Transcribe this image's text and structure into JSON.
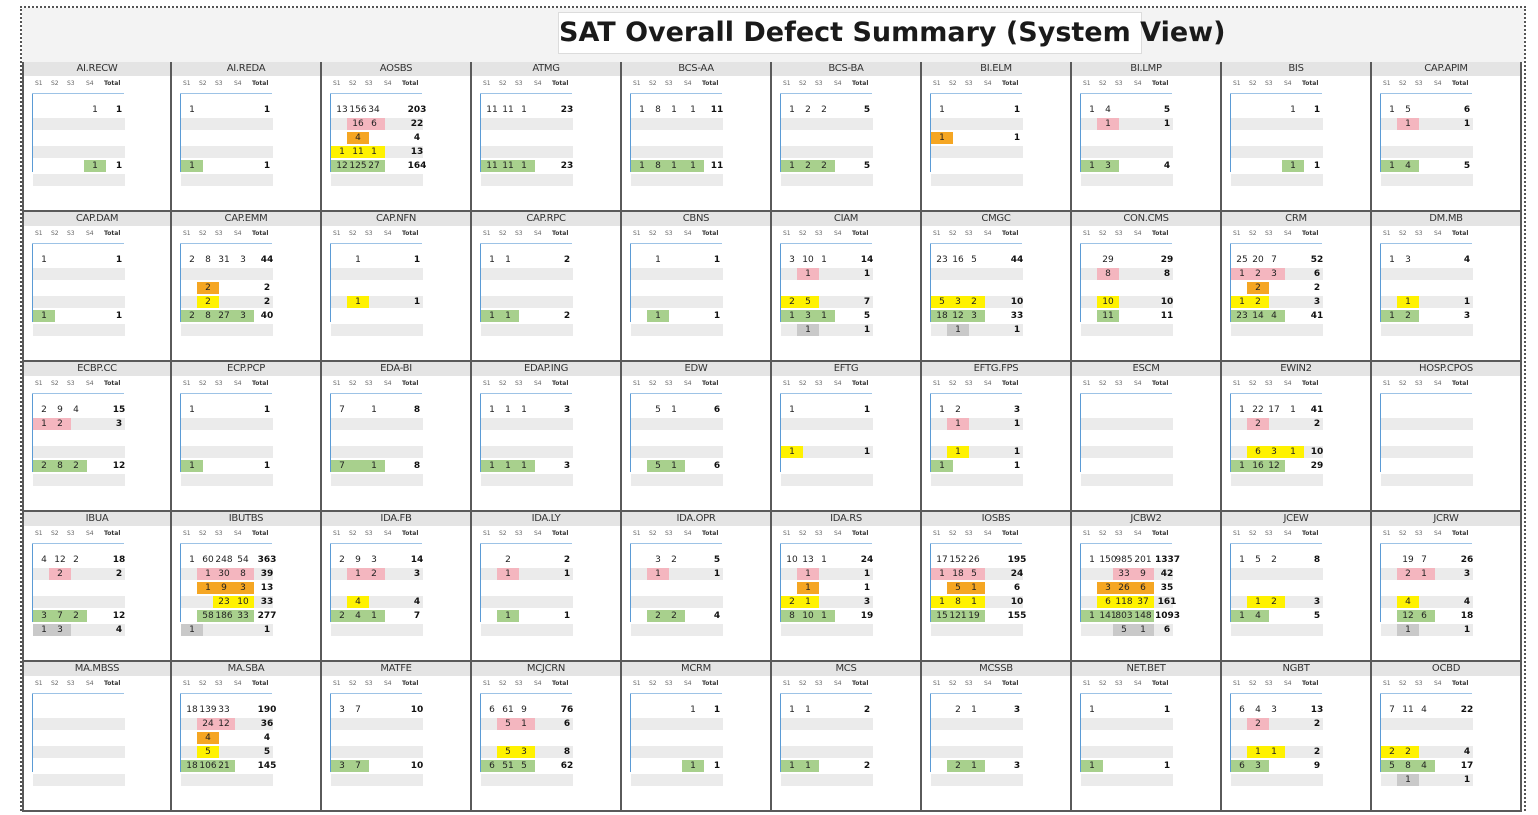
{
  "title": "SAT Overall Defect Summary (System View)",
  "columns": [
    "S1",
    "S2",
    "S3",
    "S4",
    "Total"
  ],
  "colors": {
    "s1": "#f4b6bf",
    "s2": "#f5a623",
    "s3": "#fff200",
    "s4": "#a8d08d",
    "s5": "#c9c9c9"
  },
  "panels": [
    {
      "name": "AI.RECW",
      "rows": [
        [
          "",
          "",
          "",
          "1",
          "1"
        ],
        [],
        [],
        [],
        [
          "",
          "",
          "",
          "1",
          "1"
        ]
      ]
    },
    {
      "name": "AI.REDA",
      "rows": [
        [
          "1",
          "",
          "",
          "",
          "1"
        ],
        [],
        [],
        [],
        [
          "1",
          "",
          "",
          "",
          "1"
        ]
      ]
    },
    {
      "name": "AOSBS",
      "rows": [
        [
          "13",
          "156",
          "34",
          "",
          "203"
        ],
        [
          "",
          "16",
          "6",
          "",
          "22"
        ],
        [
          "",
          "4",
          "",
          "",
          "4"
        ],
        [
          "1",
          "11",
          "1",
          "",
          "13"
        ],
        [
          "12",
          "125",
          "27",
          "",
          "164"
        ]
      ]
    },
    {
      "name": "ATMG",
      "rows": [
        [
          "11",
          "11",
          "1",
          "",
          "23"
        ],
        [],
        [],
        [],
        [
          "11",
          "11",
          "1",
          "",
          "23"
        ]
      ]
    },
    {
      "name": "BCS-AA",
      "rows": [
        [
          "1",
          "8",
          "1",
          "1",
          "11"
        ],
        [],
        [],
        [],
        [
          "1",
          "8",
          "1",
          "1",
          "11"
        ]
      ]
    },
    {
      "name": "BCS-BA",
      "rows": [
        [
          "1",
          "2",
          "2",
          "",
          "5"
        ],
        [],
        [],
        [],
        [
          "1",
          "2",
          "2",
          "",
          "5"
        ]
      ]
    },
    {
      "name": "BI.ELM",
      "rows": [
        [
          "1",
          "",
          "",
          "",
          "1"
        ],
        [],
        [
          "1",
          "",
          "",
          "",
          "1"
        ],
        [],
        []
      ]
    },
    {
      "name": "BI.LMP",
      "rows": [
        [
          "1",
          "4",
          "",
          "",
          "5"
        ],
        [
          "",
          "1",
          "",
          "",
          "1"
        ],
        [],
        [],
        [
          "1",
          "3",
          "",
          "",
          "4"
        ]
      ]
    },
    {
      "name": "BIS",
      "rows": [
        [
          "",
          "",
          "",
          "1",
          "1"
        ],
        [],
        [],
        [],
        [
          "",
          "",
          "",
          "1",
          "1"
        ]
      ]
    },
    {
      "name": "CAP.APIM",
      "rows": [
        [
          "1",
          "5",
          "",
          "",
          "6"
        ],
        [
          "",
          "1",
          "",
          "",
          "1"
        ],
        [],
        [],
        [
          "1",
          "4",
          "",
          "",
          "5"
        ]
      ]
    },
    {
      "name": "CAP.DAM",
      "rows": [
        [
          "1",
          "",
          "",
          "",
          "1"
        ],
        [],
        [],
        [],
        [
          "1",
          "",
          "",
          "",
          "1"
        ]
      ]
    },
    {
      "name": "CAP.EMM",
      "rows": [
        [
          "2",
          "8",
          "31",
          "3",
          "44"
        ],
        [],
        [
          "",
          "2",
          "",
          "",
          "2"
        ],
        [
          "",
          "2",
          "",
          "",
          "2"
        ],
        [
          "2",
          "8",
          "27",
          "3",
          "40"
        ]
      ]
    },
    {
      "name": "CAP.NFN",
      "rows": [
        [
          "",
          "1",
          "",
          "",
          "1"
        ],
        [],
        [],
        [
          "",
          "1",
          "",
          "",
          "1"
        ],
        []
      ]
    },
    {
      "name": "CAP.RPC",
      "rows": [
        [
          "1",
          "1",
          "",
          "",
          "2"
        ],
        [],
        [],
        [],
        [
          "1",
          "1",
          "",
          "",
          "2"
        ]
      ]
    },
    {
      "name": "CBNS",
      "rows": [
        [
          "",
          "1",
          "",
          "",
          "1"
        ],
        [],
        [],
        [],
        [
          "",
          "1",
          "",
          "",
          "1"
        ]
      ]
    },
    {
      "name": "CIAM",
      "rows": [
        [
          "3",
          "10",
          "1",
          "",
          "14"
        ],
        [
          "",
          "1",
          "",
          "",
          "1"
        ],
        [],
        [
          "2",
          "5",
          "",
          "",
          "7"
        ],
        [
          "1",
          "3",
          "1",
          "",
          "5"
        ],
        [
          "",
          "1",
          "",
          "",
          "1"
        ]
      ]
    },
    {
      "name": "CMGC",
      "rows": [
        [
          "23",
          "16",
          "5",
          "",
          "44"
        ],
        [],
        [],
        [
          "5",
          "3",
          "2",
          "",
          "10"
        ],
        [
          "18",
          "12",
          "3",
          "",
          "33"
        ],
        [
          "",
          "1",
          "",
          "",
          "1"
        ]
      ]
    },
    {
      "name": "CON.CMS",
      "rows": [
        [
          "",
          "29",
          "",
          "",
          "29"
        ],
        [
          "",
          "8",
          "",
          "",
          "8"
        ],
        [],
        [
          "",
          "10",
          "",
          "",
          "10"
        ],
        [
          "",
          "11",
          "",
          "",
          "11"
        ]
      ]
    },
    {
      "name": "CRM",
      "rows": [
        [
          "25",
          "20",
          "7",
          "",
          "52"
        ],
        [
          "1",
          "2",
          "3",
          "",
          "6"
        ],
        [
          "",
          "2",
          "",
          "",
          "2"
        ],
        [
          "1",
          "2",
          "",
          "",
          "3"
        ],
        [
          "23",
          "14",
          "4",
          "",
          "41"
        ]
      ]
    },
    {
      "name": "DM.MB",
      "rows": [
        [
          "1",
          "3",
          "",
          "",
          "4"
        ],
        [],
        [],
        [
          "",
          "1",
          "",
          "",
          "1"
        ],
        [
          "1",
          "2",
          "",
          "",
          "3"
        ]
      ]
    },
    {
      "name": "ECBP.CC",
      "rows": [
        [
          "2",
          "9",
          "4",
          "",
          "15"
        ],
        [
          "1",
          "2",
          "",
          "",
          "3"
        ],
        [],
        [],
        [
          "2",
          "8",
          "2",
          "",
          "12"
        ]
      ]
    },
    {
      "name": "ECP.PCP",
      "rows": [
        [
          "1",
          "",
          "",
          "",
          "1"
        ],
        [],
        [],
        [],
        [
          "1",
          "",
          "",
          "",
          "1"
        ]
      ]
    },
    {
      "name": "EDA-BI",
      "rows": [
        [
          "7",
          "",
          "1",
          "",
          "8"
        ],
        [],
        [],
        [],
        [
          "7",
          "",
          "1",
          "",
          "8"
        ]
      ]
    },
    {
      "name": "EDAP.ING",
      "rows": [
        [
          "1",
          "1",
          "1",
          "",
          "3"
        ],
        [],
        [],
        [],
        [
          "1",
          "1",
          "1",
          "",
          "3"
        ]
      ]
    },
    {
      "name": "EDW",
      "rows": [
        [
          "",
          "5",
          "1",
          "",
          "6"
        ],
        [],
        [],
        [],
        [
          "",
          "5",
          "1",
          "",
          "6"
        ]
      ]
    },
    {
      "name": "EFTG",
      "rows": [
        [
          "1",
          "",
          "",
          "",
          "1"
        ],
        [],
        [],
        [
          "1",
          "",
          "",
          "",
          "1"
        ],
        []
      ]
    },
    {
      "name": "EFTG.FPS",
      "rows": [
        [
          "1",
          "2",
          "",
          "",
          "3"
        ],
        [
          "",
          "1",
          "",
          "",
          "1"
        ],
        [],
        [
          "",
          "1",
          "",
          "",
          "1"
        ],
        [
          "1",
          "",
          "",
          "",
          "1"
        ]
      ]
    },
    {
      "name": "ESCM",
      "rows": [
        [],
        [],
        [],
        [],
        []
      ]
    },
    {
      "name": "EWIN2",
      "rows": [
        [
          "1",
          "22",
          "17",
          "1",
          "41"
        ],
        [
          "",
          "2",
          "",
          "",
          "2"
        ],
        [],
        [
          "",
          "6",
          "3",
          "1",
          "10"
        ],
        [
          "1",
          "16",
          "12",
          "",
          "29"
        ]
      ]
    },
    {
      "name": "HOSP.CPOS",
      "rows": [
        [],
        [],
        [],
        [],
        []
      ]
    },
    {
      "name": "IBUA",
      "rows": [
        [
          "4",
          "12",
          "2",
          "",
          "18"
        ],
        [
          "",
          "2",
          "",
          "",
          "2"
        ],
        [],
        [],
        [
          "3",
          "7",
          "2",
          "",
          "12"
        ],
        [
          "1",
          "3",
          "",
          "",
          "4"
        ]
      ]
    },
    {
      "name": "IBUTBS",
      "rows": [
        [
          "1",
          "60",
          "248",
          "54",
          "363"
        ],
        [
          "",
          "1",
          "30",
          "8",
          "39"
        ],
        [
          "",
          "1",
          "9",
          "3",
          "13"
        ],
        [
          "",
          "",
          "23",
          "10",
          "33"
        ],
        [
          "",
          "58",
          "186",
          "33",
          "277"
        ],
        [
          "1",
          "",
          "",
          "",
          "1"
        ]
      ]
    },
    {
      "name": "IDA.FB",
      "rows": [
        [
          "2",
          "9",
          "3",
          "",
          "14"
        ],
        [
          "",
          "1",
          "2",
          "",
          "3"
        ],
        [],
        [
          "",
          "4",
          "",
          "",
          "4"
        ],
        [
          "2",
          "4",
          "1",
          "",
          "7"
        ]
      ]
    },
    {
      "name": "IDA.LY",
      "rows": [
        [
          "",
          "2",
          "",
          "",
          "2"
        ],
        [
          "",
          "1",
          "",
          "",
          "1"
        ],
        [],
        [],
        [
          "",
          "1",
          "",
          "",
          "1"
        ]
      ]
    },
    {
      "name": "IDA.OPR",
      "rows": [
        [
          "",
          "3",
          "2",
          "",
          "5"
        ],
        [
          "",
          "1",
          "",
          "",
          "1"
        ],
        [],
        [],
        [
          "",
          "2",
          "2",
          "",
          "4"
        ]
      ]
    },
    {
      "name": "IDA.RS",
      "rows": [
        [
          "10",
          "13",
          "1",
          "",
          "24"
        ],
        [
          "",
          "1",
          "",
          "",
          "1"
        ],
        [
          "",
          "1",
          "",
          "",
          "1"
        ],
        [
          "2",
          "1",
          "",
          "",
          "3"
        ],
        [
          "8",
          "10",
          "1",
          "",
          "19"
        ]
      ]
    },
    {
      "name": "IOSBS",
      "rows": [
        [
          "17",
          "152",
          "26",
          "",
          "195"
        ],
        [
          "1",
          "18",
          "5",
          "",
          "24"
        ],
        [
          "",
          "5",
          "1",
          "",
          "6"
        ],
        [
          "1",
          "8",
          "1",
          "",
          "10"
        ],
        [
          "15",
          "121",
          "19",
          "",
          "155"
        ]
      ]
    },
    {
      "name": "JCBW2",
      "rows": [
        [
          "1",
          "150",
          "985",
          "201",
          "1337"
        ],
        [
          "",
          "",
          "33",
          "9",
          "42"
        ],
        [
          "",
          "3",
          "26",
          "6",
          "35"
        ],
        [
          "",
          "6",
          "118",
          "37",
          "161"
        ],
        [
          "1",
          "141",
          "803",
          "148",
          "1093"
        ],
        [
          "",
          "",
          "5",
          "1",
          "6"
        ]
      ]
    },
    {
      "name": "JCEW",
      "rows": [
        [
          "1",
          "5",
          "2",
          "",
          "8"
        ],
        [],
        [],
        [
          "",
          "1",
          "2",
          "",
          "3"
        ],
        [
          "1",
          "4",
          "",
          "",
          "5"
        ]
      ]
    },
    {
      "name": "JCRW",
      "rows": [
        [
          "",
          "19",
          "7",
          "",
          "26"
        ],
        [
          "",
          "2",
          "1",
          "",
          "3"
        ],
        [],
        [
          "",
          "4",
          "",
          "",
          "4"
        ],
        [
          "",
          "12",
          "6",
          "",
          "18"
        ],
        [
          "",
          "1",
          "",
          "",
          "1"
        ]
      ]
    },
    {
      "name": "MA.MBSS",
      "rows": [
        [],
        [],
        [],
        [],
        []
      ]
    },
    {
      "name": "MA.SBA",
      "rows": [
        [
          "18",
          "139",
          "33",
          "",
          "190"
        ],
        [
          "",
          "24",
          "12",
          "",
          "36"
        ],
        [
          "",
          "4",
          "",
          "",
          "4"
        ],
        [
          "",
          "5",
          "",
          "",
          "5"
        ],
        [
          "18",
          "106",
          "21",
          "",
          "145"
        ]
      ]
    },
    {
      "name": "MATFE",
      "rows": [
        [
          "3",
          "7",
          "",
          "",
          "10"
        ],
        [],
        [],
        [],
        [
          "3",
          "7",
          "",
          "",
          "10"
        ]
      ]
    },
    {
      "name": "MCJCRN",
      "rows": [
        [
          "6",
          "61",
          "9",
          "",
          "76"
        ],
        [
          "",
          "5",
          "1",
          "",
          "6"
        ],
        [],
        [
          "",
          "5",
          "3",
          "",
          "8"
        ],
        [
          "6",
          "51",
          "5",
          "",
          "62"
        ]
      ]
    },
    {
      "name": "MCRM",
      "rows": [
        [
          "",
          "",
          "",
          "1",
          "1"
        ],
        [],
        [],
        [],
        [
          "",
          "",
          "",
          "1",
          "1"
        ]
      ]
    },
    {
      "name": "MCS",
      "rows": [
        [
          "1",
          "1",
          "",
          "",
          "2"
        ],
        [],
        [],
        [],
        [
          "1",
          "1",
          "",
          "",
          "2"
        ]
      ]
    },
    {
      "name": "MCSSB",
      "rows": [
        [
          "",
          "2",
          "1",
          "",
          "3"
        ],
        [],
        [],
        [],
        [
          "",
          "2",
          "1",
          "",
          "3"
        ]
      ]
    },
    {
      "name": "NET.BET",
      "rows": [
        [
          "1",
          "",
          "",
          "",
          "1"
        ],
        [],
        [],
        [],
        [
          "1",
          "",
          "",
          "",
          "1"
        ]
      ]
    },
    {
      "name": "NGBT",
      "rows": [
        [
          "6",
          "4",
          "3",
          "",
          "13"
        ],
        [
          "",
          "2",
          "",
          "",
          "2"
        ],
        [],
        [
          "",
          "1",
          "1",
          "",
          "2"
        ],
        [
          "6",
          "3",
          "",
          "",
          "9"
        ]
      ]
    },
    {
      "name": "OCBD",
      "rows": [
        [
          "7",
          "11",
          "4",
          "",
          "22"
        ],
        [],
        [],
        [
          "2",
          "2",
          "",
          "",
          "4"
        ],
        [
          "5",
          "8",
          "4",
          "",
          "17"
        ],
        [
          "",
          "1",
          "",
          "",
          "1"
        ]
      ]
    }
  ]
}
